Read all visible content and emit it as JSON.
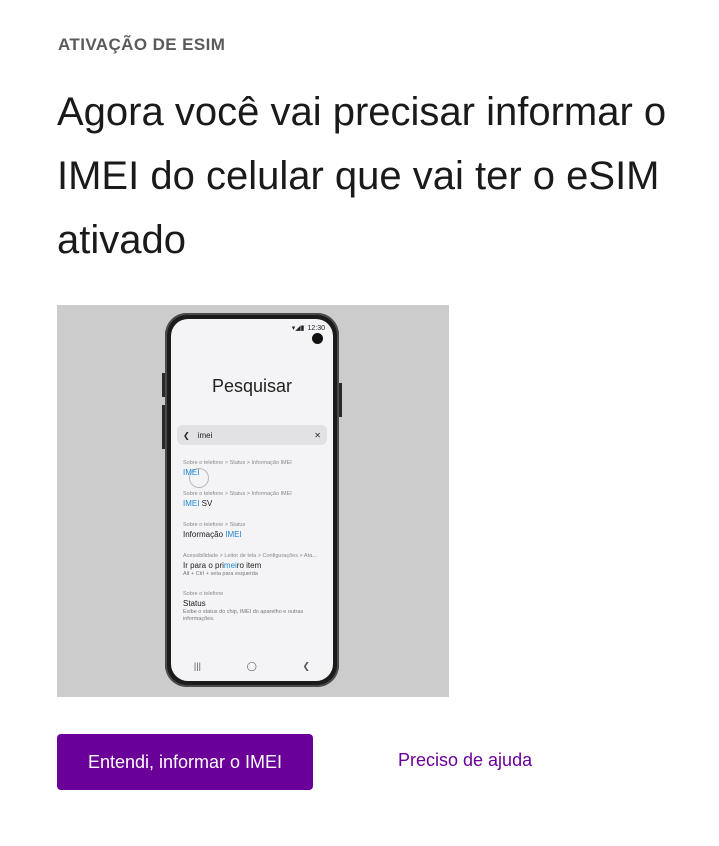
{
  "header": {
    "eyebrow": "ATIVAÇÃO DE ESIM",
    "headline": "Agora você vai precisar informar o IMEI do celular que vai ter o eSIM ativado"
  },
  "tutorial": {
    "screen_title": "Pesquisar",
    "status_time": "12:30",
    "search_query": "imei",
    "results": [
      {
        "path": "Sobre o telefone > Status > Informação IMEI",
        "main_pre": "",
        "main_hl": "IMEI",
        "main_post": "",
        "sub": ""
      },
      {
        "path": "Sobre o telefone > Status > Informação IMEI",
        "main_pre": "",
        "main_hl": "IMEI",
        "main_post": " SV",
        "sub": ""
      },
      {
        "path": "Sobre o telefone > Status",
        "main_pre": "Informação ",
        "main_hl": "IMEI",
        "main_post": "",
        "sub": ""
      },
      {
        "path": "Acessibilidade > Leitor de tela > Configurações > Ata...",
        "main_pre": "Ir para o pri",
        "main_hl": "mei",
        "main_post": "ro item",
        "sub": "Alt + Ctrl + seta para esquerda"
      },
      {
        "path": "Sobre o telefone",
        "main_pre": "Status",
        "main_hl": "",
        "main_post": "",
        "sub": "Exibe o status do chip, IMEI do aparelho e outras informações."
      }
    ]
  },
  "actions": {
    "primary_label": "Entendi, informar o IMEI",
    "help_label": "Preciso de ajuda"
  },
  "colors": {
    "brand": "#6b0099",
    "highlight": "#1e88d4"
  }
}
